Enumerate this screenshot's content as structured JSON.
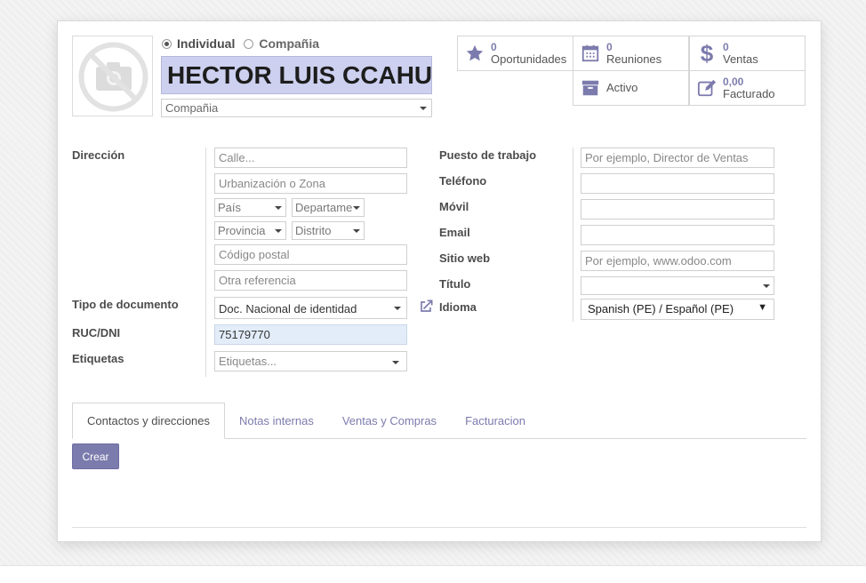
{
  "header": {
    "partner_type": {
      "individual_label": "Individual",
      "company_label": "Compañia",
      "selected": "Individual"
    },
    "name": "HECTOR LUIS CCAHUA",
    "company_placeholder": "Compañia"
  },
  "stats": {
    "opportunities": {
      "value": "0",
      "label": "Oportunidades",
      "icon": "star-icon"
    },
    "meetings": {
      "value": "0",
      "label": "Reuniones",
      "icon": "calendar-icon"
    },
    "sales": {
      "value": "0",
      "label": "Ventas",
      "icon": "dollar-icon"
    },
    "active": {
      "label": "Activo",
      "icon": "archive-icon"
    },
    "invoiced": {
      "value": "0,00",
      "label": "Facturado",
      "icon": "edit-icon"
    }
  },
  "left": {
    "address_label": "Dirección",
    "street_placeholder": "Calle...",
    "street2_placeholder": "Urbanización o Zona",
    "country_placeholder": "País",
    "state_placeholder": "Departame",
    "province_placeholder": "Provincia",
    "district_placeholder": "Distrito",
    "zip_placeholder": "Código postal",
    "reference_placeholder": "Otra referencia",
    "doc_type_label": "Tipo de documento",
    "doc_type_value": "Doc. Nacional de identidad",
    "vat_label": "RUC/DNI",
    "vat_value": "75179770",
    "tags_label": "Etiquetas",
    "tags_placeholder": "Etiquetas..."
  },
  "right": {
    "job_label": "Puesto de trabajo",
    "job_placeholder": "Por ejemplo, Director de Ventas",
    "phone_label": "Teléfono",
    "mobile_label": "Móvil",
    "email_label": "Email",
    "website_label": "Sitio web",
    "website_placeholder": "Por ejemplo, www.odoo.com",
    "title_label": "Título",
    "lang_label": "Idioma",
    "lang_value": "Spanish (PE) / Español (PE)"
  },
  "tabs": [
    "Contactos y direcciones",
    "Notas internas",
    "Ventas y Compras",
    "Facturacion"
  ],
  "active_tab": "Contactos y direcciones",
  "create_button": "Crear",
  "colors": {
    "accent": "#7c7bad",
    "name_field_bg": "#cdd0ef",
    "highlight_input": "#e2edf9"
  }
}
